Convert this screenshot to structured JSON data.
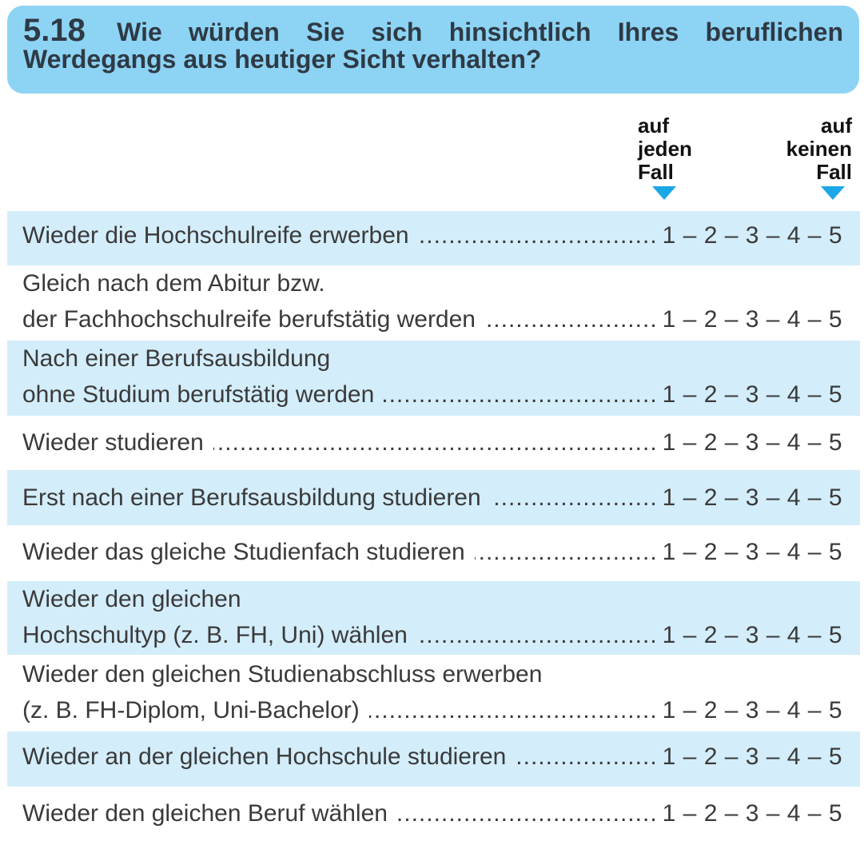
{
  "question": {
    "number": "5.18",
    "line1": "Wie würden Sie sich hinsichtlich Ihres beruflichen",
    "line2": "Werdegangs aus heutiger Sicht verhalten?"
  },
  "scale_labels": {
    "left": [
      "auf",
      "jeden",
      "Fall"
    ],
    "right": [
      "auf",
      "keinen",
      "Fall"
    ]
  },
  "scale_text": "1 – 2 – 3 – 4 – 5",
  "leader": "........................................................................................................",
  "items": [
    {
      "line1": "",
      "label": "Wieder die Hochschulreife erwerben"
    },
    {
      "line1": "Gleich nach dem Abitur bzw.",
      "label": "der Fachhochschulreife berufstätig werden"
    },
    {
      "line1": "Nach einer Berufsausbildung",
      "label": "ohne Studium berufstätig werden"
    },
    {
      "line1": "",
      "label": "Wieder studieren"
    },
    {
      "line1": "",
      "label": "Erst nach einer Berufsausbildung studieren"
    },
    {
      "line1": "",
      "label": "Wieder das gleiche Studienfach studieren"
    },
    {
      "line1": "Wieder den gleichen",
      "label": "Hochschultyp (z. B. FH, Uni) wählen"
    },
    {
      "line1": "Wieder den gleichen Studienabschluss erwerben",
      "label": "(z. B. FH-Diplom, Uni-Bachelor)"
    },
    {
      "line1": "",
      "label": "Wieder an der gleichen Hochschule studieren"
    },
    {
      "line1": "",
      "label": "Wieder den gleichen Beruf wählen"
    }
  ],
  "colors": {
    "header_bg": "#8dd3f4",
    "row_shade": "#d3edfa",
    "arrow": "#1aa7e6"
  }
}
